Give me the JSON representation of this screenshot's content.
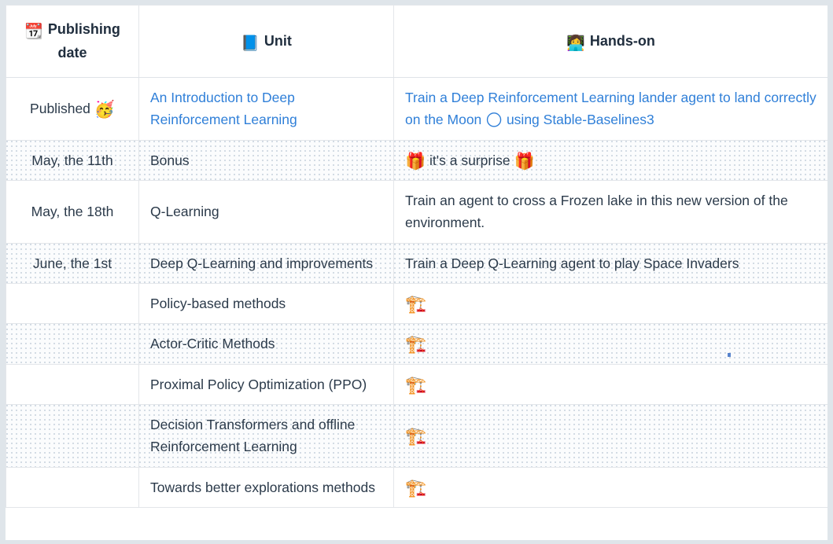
{
  "table": {
    "columns": [
      {
        "id": "publishing-date",
        "label": "Publishing date",
        "icon": "calendar-icon",
        "icon_glyph": "📆"
      },
      {
        "id": "unit",
        "label": "Unit",
        "icon": "book-icon",
        "icon_glyph": "📘"
      },
      {
        "id": "hands-on",
        "label": "Hands-on",
        "icon": "technologist-icon",
        "icon_glyph": "👩‍💻"
      }
    ],
    "rows": [
      {
        "date": "Published",
        "date_emoji": "🥳",
        "date_emoji_name": "partying-face-icon",
        "unit": "An Introduction to Deep Reinforcement Learning",
        "unit_is_link": true,
        "hands_on_pre": "Train a Deep Reinforcement Learning lander agent to land correctly on the Moon",
        "hands_on_emoji": "🌕",
        "hands_on_emoji_name": "full-moon-icon",
        "hands_on_post": "using Stable-Baselines3",
        "hands_on_is_link": true,
        "striped": false
      },
      {
        "date": "May, the 11th",
        "date_emoji": "",
        "unit": "Bonus",
        "unit_is_link": false,
        "hands_on_pre": "",
        "hands_on_emoji": "🎁",
        "hands_on_emoji_name": "gift-icon",
        "hands_on_mid": "it's a surprise",
        "hands_on_emoji2": "🎁",
        "hands_on_emoji2_name": "gift-icon",
        "hands_on_post": "",
        "hands_on_is_link": false,
        "striped": true
      },
      {
        "date": "May, the 18th",
        "date_emoji": "",
        "unit": "Q-Learning",
        "unit_is_link": false,
        "hands_on_pre": "Train an agent to cross a Frozen lake in this new version of the environment.",
        "hands_on_emoji": "",
        "hands_on_post": "",
        "hands_on_is_link": false,
        "striped": false
      },
      {
        "date": "June, the 1st",
        "date_emoji": "",
        "unit": "Deep Q-Learning and improvements",
        "unit_is_link": false,
        "hands_on_pre": "Train a Deep Q-Learning agent to play Space Invaders",
        "hands_on_emoji": "",
        "hands_on_post": "",
        "hands_on_is_link": false,
        "striped": true
      },
      {
        "date": "",
        "date_emoji": "",
        "unit": "Policy-based methods",
        "unit_is_link": false,
        "hands_on_pre": "",
        "hands_on_emoji": "🏗️",
        "hands_on_emoji_name": "construction-icon",
        "hands_on_post": "",
        "hands_on_is_link": false,
        "striped": false
      },
      {
        "date": "",
        "date_emoji": "",
        "unit": "Actor-Critic Methods",
        "unit_is_link": false,
        "hands_on_pre": "",
        "hands_on_emoji": "🏗️",
        "hands_on_emoji_name": "construction-icon",
        "hands_on_post": "",
        "hands_on_is_link": false,
        "striped": true
      },
      {
        "date": "",
        "date_emoji": "",
        "unit": "Proximal Policy Optimization (PPO)",
        "unit_is_link": false,
        "hands_on_pre": "",
        "hands_on_emoji": "🏗️",
        "hands_on_emoji_name": "construction-icon",
        "hands_on_post": "",
        "hands_on_is_link": false,
        "striped": false
      },
      {
        "date": "",
        "date_emoji": "",
        "unit": "Decision Transformers and offline Reinforcement Learning",
        "unit_is_link": false,
        "hands_on_pre": "",
        "hands_on_emoji": "🏗️",
        "hands_on_emoji_name": "construction-icon",
        "hands_on_post": "",
        "hands_on_is_link": false,
        "striped": true
      },
      {
        "date": "",
        "date_emoji": "",
        "unit": "Towards better explorations methods",
        "unit_is_link": false,
        "hands_on_pre": "",
        "hands_on_emoji": "🏗️",
        "hands_on_emoji_name": "construction-icon",
        "hands_on_post": "",
        "hands_on_is_link": false,
        "striped": false
      }
    ]
  },
  "colors": {
    "link": "#2f7fd8",
    "text": "#2b3a4a",
    "border": "#e3e6ea",
    "stripe": "#fbfcfd",
    "frame": "#dfe5ea"
  }
}
